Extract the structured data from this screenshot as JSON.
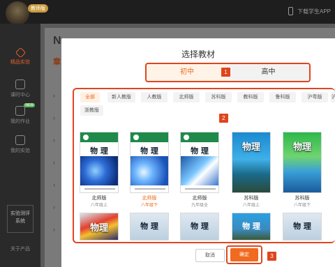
{
  "app": {
    "badge": "教师版",
    "download_label": "下载学生APP",
    "bg_title": "N",
    "bg_subtitle": "章"
  },
  "sidebar": {
    "items": [
      {
        "label": "精品实验",
        "icon": "diamond-icon",
        "active": true
      },
      {
        "label": "课时中心",
        "icon": "screen-icon"
      },
      {
        "label": "我的作业",
        "icon": "homework-icon",
        "badge": "NEW"
      },
      {
        "label": "我的实验",
        "icon": "lab-icon"
      }
    ],
    "box_text_1": "实验测评",
    "box_text_2": "系统",
    "footer_label": "关于产品"
  },
  "modal": {
    "title": "选择教材",
    "tabs": [
      {
        "label": "初中",
        "active": true
      },
      {
        "label": "高中",
        "active": false
      }
    ],
    "annotations": [
      "1",
      "2",
      "3"
    ],
    "editions": [
      "全部",
      "新人教版",
      "人教版",
      "北师版",
      "苏科版",
      "教科版",
      "鲁科版",
      "沪粤版",
      "沪",
      "浙教版"
    ],
    "books_row1": [
      {
        "title": "物 理",
        "edition": "北师版",
        "grade": "八年级上",
        "selected": false
      },
      {
        "title": "物 理",
        "edition": "北师版",
        "grade": "八年级下",
        "selected": true
      },
      {
        "title": "物 理",
        "edition": "北师版",
        "grade": "九年级全",
        "selected": false
      },
      {
        "title": "物理",
        "title_sub": "八 上",
        "edition": "苏科版",
        "grade": "八年级上",
        "selected": false
      },
      {
        "title": "物理",
        "title_sub": "八 下",
        "edition": "苏科版",
        "grade": "八年级下",
        "selected": false
      }
    ],
    "books_row2": [
      {
        "title": "物理",
        "title_sub": "九"
      },
      {
        "title": "物 理"
      },
      {
        "title": "物 理"
      },
      {
        "title": "物 理"
      },
      {
        "title": "物 理"
      }
    ],
    "cancel_label": "取消",
    "ok_label": "确定"
  },
  "colors": {
    "accent": "#ee6a1a",
    "annotation": "#e0451e"
  }
}
